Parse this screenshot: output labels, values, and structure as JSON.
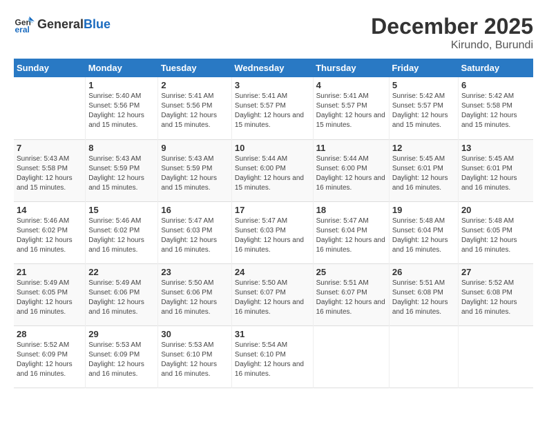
{
  "header": {
    "logo_general": "General",
    "logo_blue": "Blue",
    "month_year": "December 2025",
    "location": "Kirundo, Burundi"
  },
  "weekdays": [
    "Sunday",
    "Monday",
    "Tuesday",
    "Wednesday",
    "Thursday",
    "Friday",
    "Saturday"
  ],
  "weeks": [
    [
      {
        "day": "",
        "sunrise": "",
        "sunset": "",
        "daylight": ""
      },
      {
        "day": "1",
        "sunrise": "Sunrise: 5:40 AM",
        "sunset": "Sunset: 5:56 PM",
        "daylight": "Daylight: 12 hours and 15 minutes."
      },
      {
        "day": "2",
        "sunrise": "Sunrise: 5:41 AM",
        "sunset": "Sunset: 5:56 PM",
        "daylight": "Daylight: 12 hours and 15 minutes."
      },
      {
        "day": "3",
        "sunrise": "Sunrise: 5:41 AM",
        "sunset": "Sunset: 5:57 PM",
        "daylight": "Daylight: 12 hours and 15 minutes."
      },
      {
        "day": "4",
        "sunrise": "Sunrise: 5:41 AM",
        "sunset": "Sunset: 5:57 PM",
        "daylight": "Daylight: 12 hours and 15 minutes."
      },
      {
        "day": "5",
        "sunrise": "Sunrise: 5:42 AM",
        "sunset": "Sunset: 5:57 PM",
        "daylight": "Daylight: 12 hours and 15 minutes."
      },
      {
        "day": "6",
        "sunrise": "Sunrise: 5:42 AM",
        "sunset": "Sunset: 5:58 PM",
        "daylight": "Daylight: 12 hours and 15 minutes."
      }
    ],
    [
      {
        "day": "7",
        "sunrise": "Sunrise: 5:43 AM",
        "sunset": "Sunset: 5:58 PM",
        "daylight": "Daylight: 12 hours and 15 minutes."
      },
      {
        "day": "8",
        "sunrise": "Sunrise: 5:43 AM",
        "sunset": "Sunset: 5:59 PM",
        "daylight": "Daylight: 12 hours and 15 minutes."
      },
      {
        "day": "9",
        "sunrise": "Sunrise: 5:43 AM",
        "sunset": "Sunset: 5:59 PM",
        "daylight": "Daylight: 12 hours and 15 minutes."
      },
      {
        "day": "10",
        "sunrise": "Sunrise: 5:44 AM",
        "sunset": "Sunset: 6:00 PM",
        "daylight": "Daylight: 12 hours and 15 minutes."
      },
      {
        "day": "11",
        "sunrise": "Sunrise: 5:44 AM",
        "sunset": "Sunset: 6:00 PM",
        "daylight": "Daylight: 12 hours and 16 minutes."
      },
      {
        "day": "12",
        "sunrise": "Sunrise: 5:45 AM",
        "sunset": "Sunset: 6:01 PM",
        "daylight": "Daylight: 12 hours and 16 minutes."
      },
      {
        "day": "13",
        "sunrise": "Sunrise: 5:45 AM",
        "sunset": "Sunset: 6:01 PM",
        "daylight": "Daylight: 12 hours and 16 minutes."
      }
    ],
    [
      {
        "day": "14",
        "sunrise": "Sunrise: 5:46 AM",
        "sunset": "Sunset: 6:02 PM",
        "daylight": "Daylight: 12 hours and 16 minutes."
      },
      {
        "day": "15",
        "sunrise": "Sunrise: 5:46 AM",
        "sunset": "Sunset: 6:02 PM",
        "daylight": "Daylight: 12 hours and 16 minutes."
      },
      {
        "day": "16",
        "sunrise": "Sunrise: 5:47 AM",
        "sunset": "Sunset: 6:03 PM",
        "daylight": "Daylight: 12 hours and 16 minutes."
      },
      {
        "day": "17",
        "sunrise": "Sunrise: 5:47 AM",
        "sunset": "Sunset: 6:03 PM",
        "daylight": "Daylight: 12 hours and 16 minutes."
      },
      {
        "day": "18",
        "sunrise": "Sunrise: 5:47 AM",
        "sunset": "Sunset: 6:04 PM",
        "daylight": "Daylight: 12 hours and 16 minutes."
      },
      {
        "day": "19",
        "sunrise": "Sunrise: 5:48 AM",
        "sunset": "Sunset: 6:04 PM",
        "daylight": "Daylight: 12 hours and 16 minutes."
      },
      {
        "day": "20",
        "sunrise": "Sunrise: 5:48 AM",
        "sunset": "Sunset: 6:05 PM",
        "daylight": "Daylight: 12 hours and 16 minutes."
      }
    ],
    [
      {
        "day": "21",
        "sunrise": "Sunrise: 5:49 AM",
        "sunset": "Sunset: 6:05 PM",
        "daylight": "Daylight: 12 hours and 16 minutes."
      },
      {
        "day": "22",
        "sunrise": "Sunrise: 5:49 AM",
        "sunset": "Sunset: 6:06 PM",
        "daylight": "Daylight: 12 hours and 16 minutes."
      },
      {
        "day": "23",
        "sunrise": "Sunrise: 5:50 AM",
        "sunset": "Sunset: 6:06 PM",
        "daylight": "Daylight: 12 hours and 16 minutes."
      },
      {
        "day": "24",
        "sunrise": "Sunrise: 5:50 AM",
        "sunset": "Sunset: 6:07 PM",
        "daylight": "Daylight: 12 hours and 16 minutes."
      },
      {
        "day": "25",
        "sunrise": "Sunrise: 5:51 AM",
        "sunset": "Sunset: 6:07 PM",
        "daylight": "Daylight: 12 hours and 16 minutes."
      },
      {
        "day": "26",
        "sunrise": "Sunrise: 5:51 AM",
        "sunset": "Sunset: 6:08 PM",
        "daylight": "Daylight: 12 hours and 16 minutes."
      },
      {
        "day": "27",
        "sunrise": "Sunrise: 5:52 AM",
        "sunset": "Sunset: 6:08 PM",
        "daylight": "Daylight: 12 hours and 16 minutes."
      }
    ],
    [
      {
        "day": "28",
        "sunrise": "Sunrise: 5:52 AM",
        "sunset": "Sunset: 6:09 PM",
        "daylight": "Daylight: 12 hours and 16 minutes."
      },
      {
        "day": "29",
        "sunrise": "Sunrise: 5:53 AM",
        "sunset": "Sunset: 6:09 PM",
        "daylight": "Daylight: 12 hours and 16 minutes."
      },
      {
        "day": "30",
        "sunrise": "Sunrise: 5:53 AM",
        "sunset": "Sunset: 6:10 PM",
        "daylight": "Daylight: 12 hours and 16 minutes."
      },
      {
        "day": "31",
        "sunrise": "Sunrise: 5:54 AM",
        "sunset": "Sunset: 6:10 PM",
        "daylight": "Daylight: 12 hours and 16 minutes."
      },
      {
        "day": "",
        "sunrise": "",
        "sunset": "",
        "daylight": ""
      },
      {
        "day": "",
        "sunrise": "",
        "sunset": "",
        "daylight": ""
      },
      {
        "day": "",
        "sunrise": "",
        "sunset": "",
        "daylight": ""
      }
    ]
  ]
}
